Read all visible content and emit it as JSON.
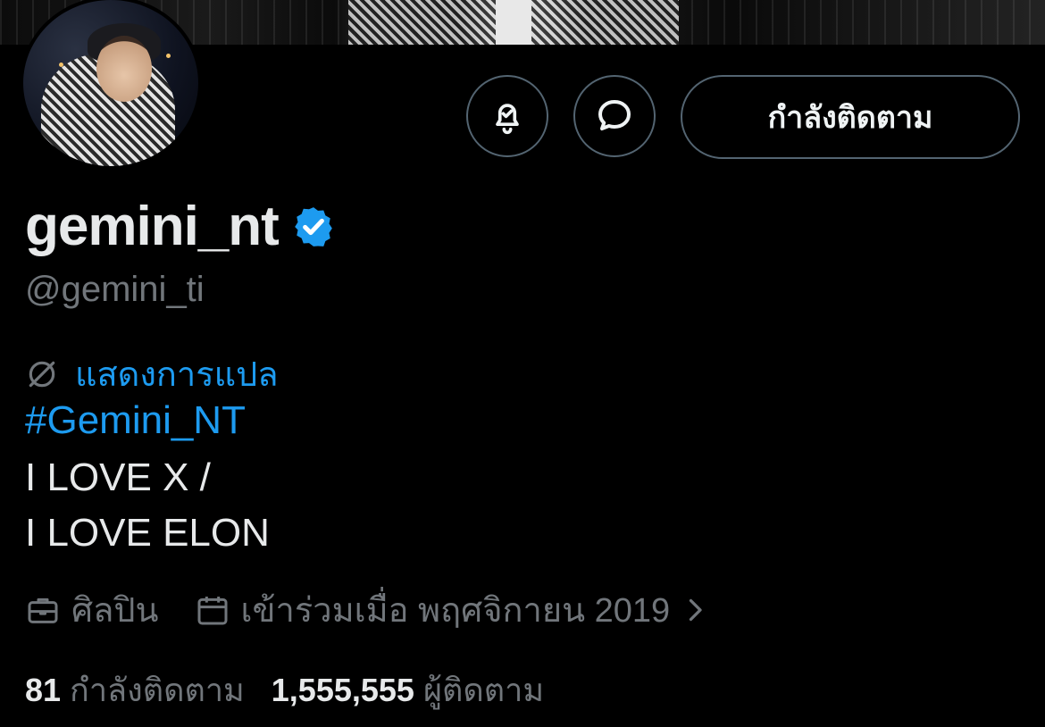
{
  "profile": {
    "display_name": "gemini_nt",
    "handle": "@gemini_ti",
    "verified_icon": "verified-badge-icon",
    "translate_label": "แสดงการแปล",
    "bio": {
      "hashtag": "#Gemini_NT",
      "line1": "I LOVE X /",
      "line2": "I LOVE ELON"
    },
    "category": "ศิลปิน",
    "joined": "เข้าร่วมเมื่อ พฤศจิกายน 2019",
    "following_count": "81",
    "following_label": "กำลังติดตาม",
    "followers_count": "1,555,555",
    "followers_label": "ผู้ติดตาม"
  },
  "actions": {
    "notify_icon": "bell-check-icon",
    "message_icon": "message-bubble-icon",
    "follow_state_label": "กำลังติดตาม"
  },
  "colors": {
    "background": "#000000",
    "text_primary": "#e7e9ea",
    "text_secondary": "#71767b",
    "accent": "#1d9bf0",
    "border": "#536471"
  }
}
